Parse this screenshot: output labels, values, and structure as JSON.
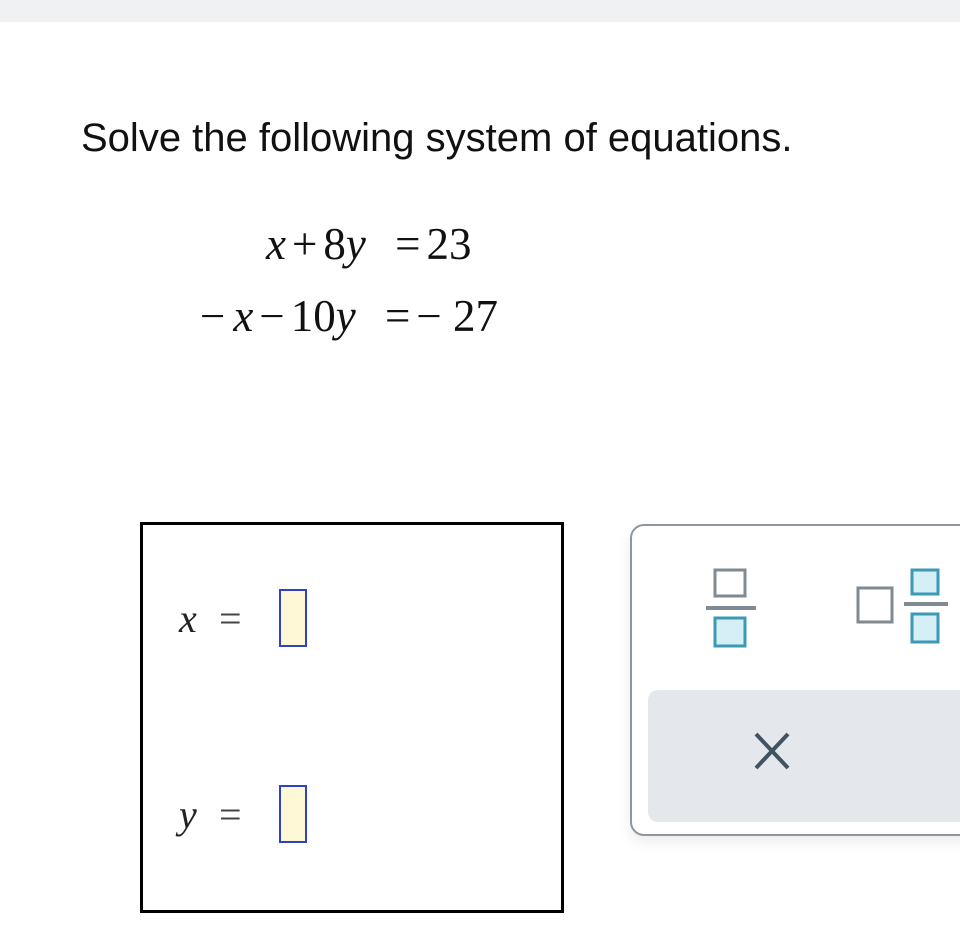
{
  "prompt": {
    "text": "Solve the following system of equations."
  },
  "equations": [
    {
      "lhs_a": "x",
      "op1": "+",
      "coef": "8",
      "var2": "y",
      "eq": "=",
      "rhs": "23"
    },
    {
      "neg": "−",
      "lhs_a": "x",
      "op1": "−",
      "coef": "10",
      "var2": "y",
      "eq": "=",
      "rhs": "− 27"
    }
  ],
  "answer": {
    "x_label": "x",
    "y_label": "y",
    "equals": "=",
    "x_value": "",
    "y_value": ""
  },
  "palette": {
    "buttons": [
      "fraction-icon",
      "mixed-number-icon",
      "clear-x-icon"
    ],
    "accent_color": "#3b9bb5",
    "fill_color": "#d6eef5"
  }
}
